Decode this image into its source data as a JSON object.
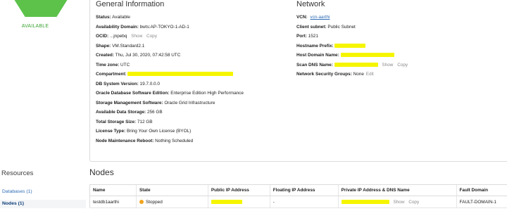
{
  "status_tile": {
    "state": "AVAILABLE",
    "accent": "#5cc24a"
  },
  "general": {
    "title": "General Information",
    "rows": [
      {
        "key": "Status:",
        "value": "Available"
      },
      {
        "key": "Availability Domain:",
        "value": "bwts:AP-TOKYO-1-AD-1"
      },
      {
        "key": "OCID:",
        "value": "...jnpebq",
        "links": [
          "Show",
          "Copy"
        ]
      },
      {
        "key": "Shape:",
        "value": "VM.Standard2.1"
      },
      {
        "key": "Created:",
        "value": "Thu, Jul 30, 2020, 07:42:58 UTC"
      },
      {
        "key": "Time zone:",
        "value": "UTC"
      },
      {
        "key": "Compartment:",
        "value": ""
      },
      {
        "key": "DB System Version:",
        "value": "19.7.0.0.0"
      },
      {
        "key": "Oracle Database Software Edition:",
        "value": "Enterprise Edition High Performance"
      },
      {
        "key": "Storage Management Software:",
        "value": "Oracle Grid Infrastructure"
      },
      {
        "key": "Available Data Storage:",
        "value": "256 GB"
      },
      {
        "key": "Total Storage Size:",
        "value": "712 GB"
      },
      {
        "key": "License Type:",
        "value": "Bring Your Own License (BYOL)"
      },
      {
        "key": "Node Maintenance Reboot:",
        "value": "Nothing Scheduled"
      }
    ]
  },
  "network": {
    "title": "Network",
    "vcn_key": "VCN:",
    "vcn_value": "vcn-aarthi",
    "client_subnet_key": "Client subnet:",
    "client_subnet_value": "Public Subnet",
    "port_key": "Port:",
    "port_value": "1521",
    "hostname_prefix_key": "Hostname Prefix:",
    "host_domain_key": "Host Domain Name:",
    "scan_dns_key": "Scan DNS Name:",
    "scan_links": [
      "Show",
      "Copy"
    ],
    "nsg_key": "Network Security Groups:",
    "nsg_value": "None",
    "nsg_edit": "Edit"
  },
  "resources": {
    "title": "Resources",
    "items": [
      {
        "label": "Databases (1)"
      },
      {
        "label": "Nodes (1)"
      }
    ]
  },
  "nodes": {
    "title": "Nodes",
    "columns": [
      "Name",
      "State",
      "Public IP Address",
      "Floating IP Address",
      "Private IP Address & DNS Name",
      "Fault Domain"
    ],
    "rows": [
      {
        "name": "testdb1aarthi",
        "state": "Stopped",
        "floating_ip": "-",
        "links": [
          "Show",
          "Copy"
        ],
        "fault_domain": "FAULT-DOMAIN-1"
      }
    ]
  },
  "colors": {
    "link": "#2d6bb5",
    "stopped": "#f2a41f",
    "redaction": "#f5f500"
  }
}
